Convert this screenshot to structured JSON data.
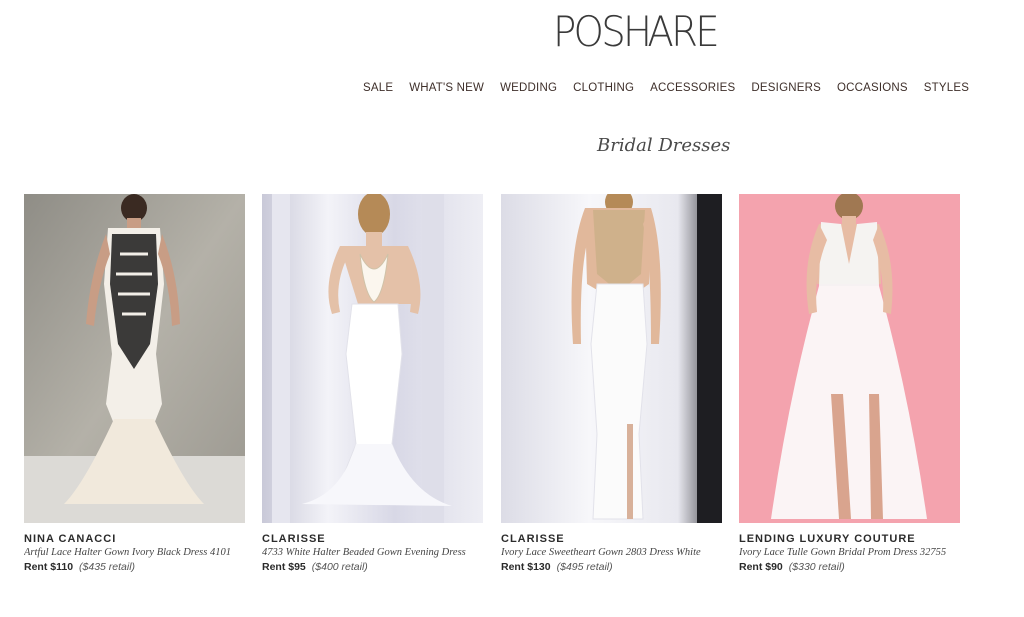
{
  "logo": {
    "part1": "POS",
    "part2": "H",
    "part3": "ARE"
  },
  "nav": {
    "items": [
      "SALE",
      "WHAT'S NEW",
      "WEDDING",
      "CLOTHING",
      "ACCESSORIES",
      "DESIGNERS",
      "OCCASIONS",
      "STYLES"
    ],
    "search_icon": "search-icon"
  },
  "page": {
    "title": "Bridal Dresses"
  },
  "products": [
    {
      "brand": "NINA CANACCI",
      "name": "Artful Lace Halter Gown Ivory Black Dress 4101",
      "rent": "Rent $110",
      "retail": "($435 retail)"
    },
    {
      "brand": "CLARISSE",
      "name": "4733 White Halter Beaded Gown Evening Dress",
      "rent": "Rent $95",
      "retail": "($400 retail)"
    },
    {
      "brand": "CLARISSE",
      "name": "Ivory Lace Sweetheart Gown 2803 Dress White",
      "rent": "Rent $130",
      "retail": "($495 retail)"
    },
    {
      "brand": "LENDING LUXURY COUTURE",
      "name": "Ivory Lace Tulle Gown Bridal Prom Dress 32755",
      "rent": "Rent $90",
      "retail": "($330 retail)"
    }
  ],
  "colors": {
    "accent": "#3e2f2a",
    "pink_bg": "#f4a3ae"
  }
}
